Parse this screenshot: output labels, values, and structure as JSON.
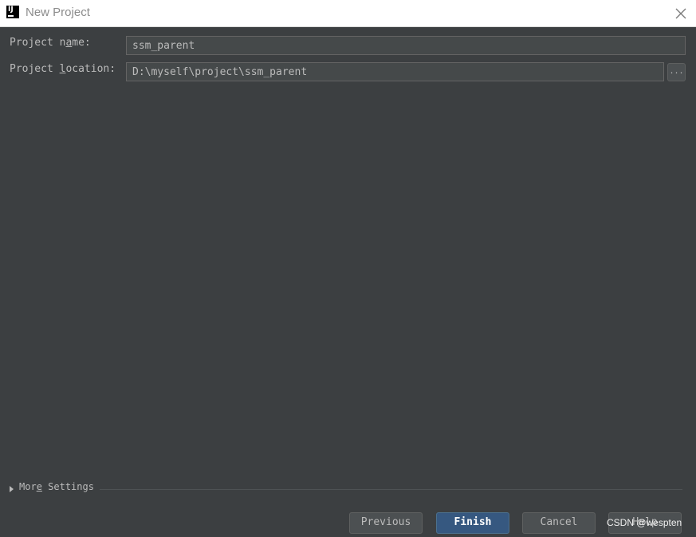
{
  "window": {
    "title": "New Project",
    "logo_text": "IJ"
  },
  "form": {
    "project_name": {
      "label_before": "Project n",
      "label_mnemonic": "a",
      "label_after": "me:",
      "value": "ssm_parent"
    },
    "project_location": {
      "label_before": "Project ",
      "label_mnemonic": "l",
      "label_after": "ocation:",
      "value": "D:\\myself\\project\\ssm_parent",
      "browse_label": "..."
    }
  },
  "more_settings": {
    "label_before": "Mor",
    "label_mnemonic": "e",
    "label_after": " Settings"
  },
  "buttons": {
    "previous": "Previous",
    "finish": "Finish",
    "cancel": "Cancel",
    "help": "Help"
  },
  "watermark": "CSDN @wespten",
  "colors": {
    "background": "#3c3f41",
    "primary_button": "#365880",
    "text": "#bbbbbb"
  }
}
